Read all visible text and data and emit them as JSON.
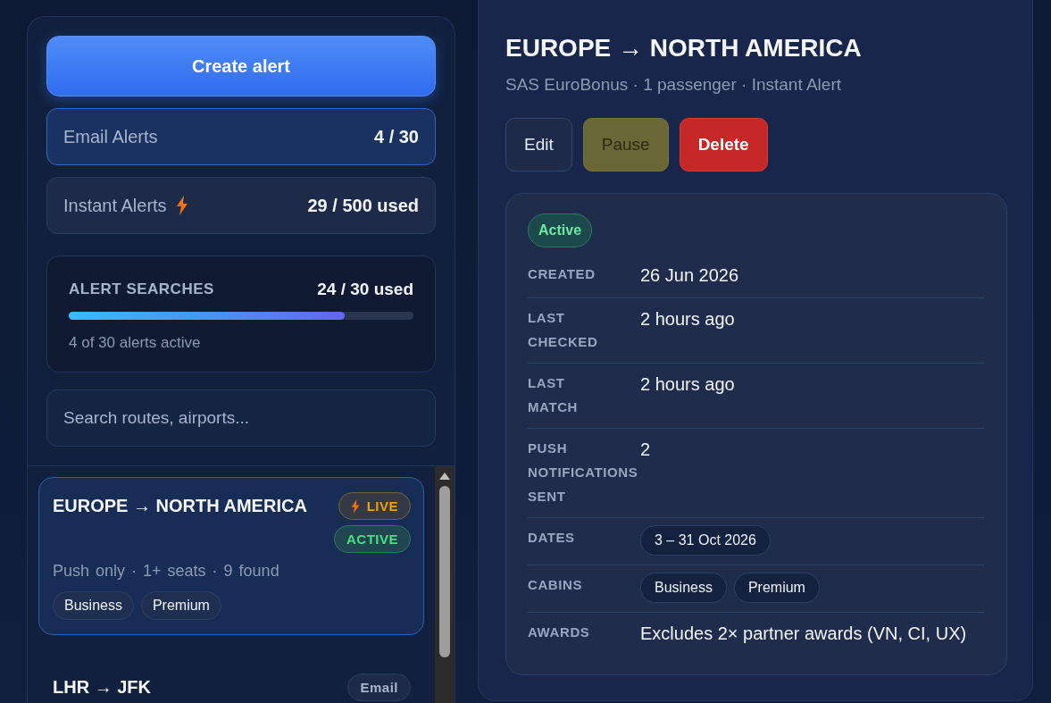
{
  "sidebar": {
    "create_button": "Create alert",
    "quotas": [
      {
        "label": "Email Alerts",
        "value": "4 / 30",
        "selected": true,
        "bolt": false
      },
      {
        "label": "Instant Alerts",
        "value": "29 / 500 used",
        "selected": false,
        "bolt": true
      }
    ],
    "usage": {
      "title": "ALERT SEARCHES",
      "value": "24 / 30 used",
      "level": 0.8,
      "note": "4 of 30 alerts active"
    },
    "search": {
      "placeholder": "Search routes, airports..."
    },
    "alerts": [
      {
        "route": "EUROPE → NORTH AMERICA",
        "selected": true,
        "badges": [
          {
            "kind": "live",
            "label": "LIVE"
          },
          {
            "kind": "active",
            "label": "ACTIVE"
          }
        ],
        "meta": "Push only · 1+ seats · 9 found",
        "tags": [
          "Business",
          "Premium"
        ]
      },
      {
        "route": "LHR → JFK",
        "selected": false,
        "badges": [
          {
            "kind": "email",
            "label": "Email"
          }
        ]
      }
    ]
  },
  "detail": {
    "title": "EUROPE → NORTH AMERICA",
    "subtitle": "SAS EuroBonus · 1 passenger · Instant Alert",
    "actions": [
      {
        "kind": "neutral",
        "label": "Edit"
      },
      {
        "kind": "warning",
        "label": "Pause"
      },
      {
        "kind": "danger",
        "label": "Delete"
      }
    ],
    "status": "Active",
    "rows": [
      {
        "label": "CREATED",
        "kind": "text",
        "value": "26 Jun 2026"
      },
      {
        "label": "LAST CHECKED",
        "kind": "text",
        "value": "2 hours ago"
      },
      {
        "label": "LAST MATCH",
        "kind": "text",
        "value": "2 hours ago"
      },
      {
        "label": "PUSH NOTIFICATIONS SENT",
        "kind": "text",
        "value": "2"
      },
      {
        "label": "DATES",
        "kind": "chips",
        "chips": [
          "3 – 31 Oct 2026"
        ]
      },
      {
        "label": "CABINS",
        "kind": "chips",
        "chips": [
          "Business",
          "Premium"
        ]
      },
      {
        "label": "AWARDS",
        "kind": "text",
        "value": "Excludes 2× partner awards (VN, CI, UX)"
      }
    ]
  }
}
